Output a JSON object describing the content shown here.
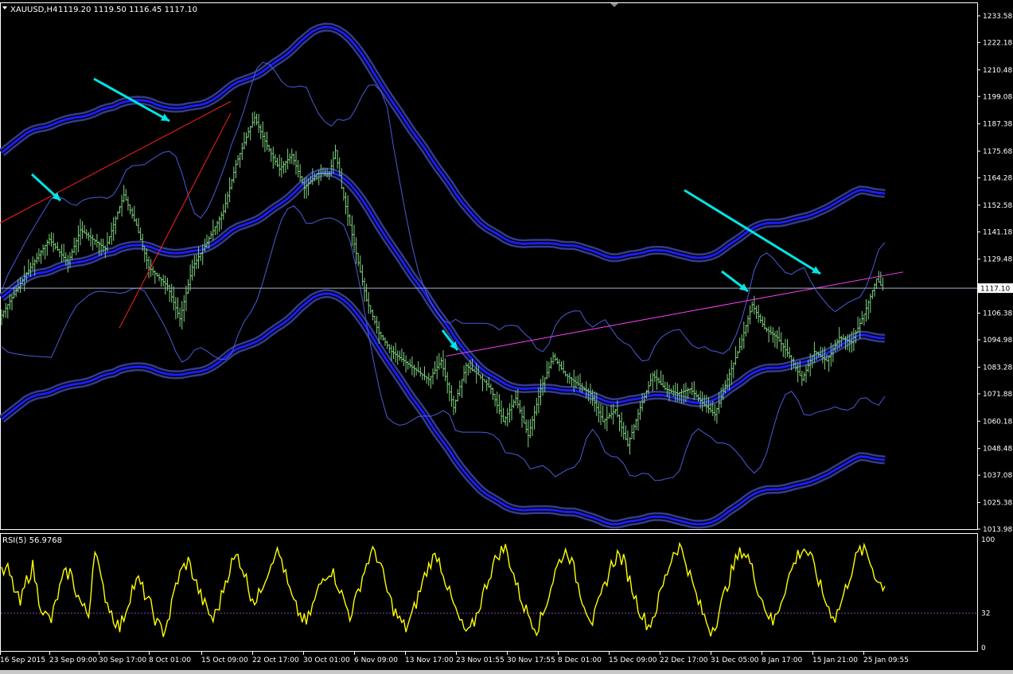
{
  "window": {
    "symbol_title": "XAUUSD,H4",
    "ohlc_text": "1119.20 1119.50 1116.45 1117.10"
  },
  "chart_data": [
    {
      "type": "candlestick",
      "name": "XAUUSD,H4",
      "ylim": [
        1013.98,
        1239.0
      ],
      "y_ticks": [
        1233.58,
        1222.18,
        1210.48,
        1199.08,
        1187.38,
        1175.68,
        1164.28,
        1152.58,
        1141.18,
        1129.48,
        1106.38,
        1094.98,
        1083.28,
        1071.88,
        1060.18,
        1048.48,
        1037.08,
        1025.38,
        1013.98
      ],
      "current_price": 1117.1,
      "x_tick_labels": [
        "16 Sep 2015",
        "23 Sep 09:00",
        "30 Sep 17:00",
        "8 Oct 01:00",
        "15 Oct 09:00",
        "22 Oct 17:00",
        "30 Oct 01:00",
        "6 Nov 09:00",
        "13 Nov 17:00",
        "23 Nov 01:55",
        "30 Nov 17:55",
        "8 Dec 01:00",
        "15 Dec 09:00",
        "22 Dec 17:00",
        "31 Dec 05:00",
        "8 Jan 17:00",
        "15 Jan 21:00",
        "25 Jan 09:55"
      ],
      "price_path": [
        [
          0,
          1104
        ],
        [
          4,
          1122
        ],
        [
          8,
          1138
        ],
        [
          11,
          1128
        ],
        [
          13,
          1142
        ],
        [
          17,
          1134
        ],
        [
          20,
          1157
        ],
        [
          22,
          1144
        ],
        [
          24,
          1126
        ],
        [
          27,
          1118
        ],
        [
          29,
          1104
        ],
        [
          31,
          1126
        ],
        [
          33,
          1135
        ],
        [
          36,
          1150
        ],
        [
          38,
          1170
        ],
        [
          40,
          1184
        ],
        [
          41,
          1190
        ],
        [
          43,
          1178
        ],
        [
          45,
          1168
        ],
        [
          47,
          1174
        ],
        [
          49,
          1160
        ],
        [
          51,
          1166
        ],
        [
          53,
          1166
        ],
        [
          54,
          1176
        ],
        [
          55,
          1160
        ],
        [
          57,
          1136
        ],
        [
          59,
          1112
        ],
        [
          61,
          1098
        ],
        [
          63,
          1090
        ],
        [
          65,
          1086
        ],
        [
          67,
          1082
        ],
        [
          69,
          1078
        ],
        [
          71,
          1086
        ],
        [
          73,
          1066
        ],
        [
          75,
          1084
        ],
        [
          77,
          1080
        ],
        [
          79,
          1074
        ],
        [
          81,
          1060
        ],
        [
          83,
          1070
        ],
        [
          85,
          1054
        ],
        [
          87,
          1074
        ],
        [
          89,
          1088
        ],
        [
          91,
          1080
        ],
        [
          93,
          1076
        ],
        [
          95,
          1072
        ],
        [
          97,
          1060
        ],
        [
          99,
          1065
        ],
        [
          101,
          1050
        ],
        [
          103,
          1066
        ],
        [
          105,
          1080
        ],
        [
          107,
          1074
        ],
        [
          109,
          1072
        ],
        [
          111,
          1074
        ],
        [
          113,
          1068
        ],
        [
          115,
          1063
        ],
        [
          117,
          1078
        ],
        [
          119,
          1092
        ],
        [
          121,
          1110
        ],
        [
          123,
          1100
        ],
        [
          125,
          1096
        ],
        [
          127,
          1088
        ],
        [
          129,
          1078
        ],
        [
          131,
          1090
        ],
        [
          133,
          1086
        ],
        [
          135,
          1096
        ],
        [
          137,
          1094
        ],
        [
          139,
          1106
        ],
        [
          141,
          1121
        ],
        [
          142,
          1117.1
        ]
      ],
      "n_bars": 143
    },
    {
      "type": "line",
      "name": "RSI(5) 56.9768",
      "ylim": [
        0,
        100
      ],
      "y_ticks": [
        100,
        32,
        0
      ],
      "level": 32,
      "line_color": "#FFFF00",
      "values": [
        68,
        72,
        55,
        40,
        62,
        75,
        45,
        30,
        25,
        48,
        66,
        70,
        52,
        38,
        30,
        95,
        60,
        42,
        28,
        18,
        35,
        55,
        62,
        50,
        38,
        22,
        15,
        30,
        58,
        72,
        80,
        64,
        48,
        35,
        26,
        40,
        62,
        78,
        85,
        70,
        50,
        42,
        60,
        74,
        90,
        82,
        58,
        40,
        30,
        22,
        38,
        55,
        68,
        72,
        60,
        44,
        30,
        45,
        66,
        82,
        90,
        74,
        52,
        36,
        25,
        18,
        30,
        48,
        66,
        80,
        86,
        70,
        50,
        34,
        20,
        12,
        24,
        42,
        60,
        76,
        88,
        92,
        74,
        54,
        38,
        28,
        18,
        30,
        50,
        70,
        84,
        90,
        72,
        52,
        36,
        24,
        40,
        58,
        76,
        86,
        80,
        62,
        44,
        30,
        20,
        32,
        52,
        70,
        88,
        94,
        80,
        60,
        42,
        28,
        16,
        26,
        46,
        64,
        80,
        90,
        84,
        66,
        48,
        34,
        22,
        38,
        56,
        72,
        86,
        92,
        84,
        68,
        50,
        36,
        28,
        42,
        60,
        78,
        90,
        88,
        74,
        60,
        56.98
      ]
    }
  ],
  "annotations": {
    "trendlines": [
      "red",
      "magenta"
    ],
    "arrows": [
      "cyan"
    ]
  },
  "colors": {
    "background": "#000000",
    "candle": "#7FD27F",
    "bollinger": "#4A5BD8",
    "envelope_core": "#1C1CFF",
    "envelope_outer": "#343C8C",
    "trend_red": "#FF2020",
    "trend_magenta": "#FF40FF",
    "arrow": "#00E5E5",
    "rsi": "#FFFF00",
    "grid_line": "#9AB0C8",
    "rsi_level": "#8040A0"
  },
  "icons": [
    "dropdown-triangle-icon"
  ]
}
